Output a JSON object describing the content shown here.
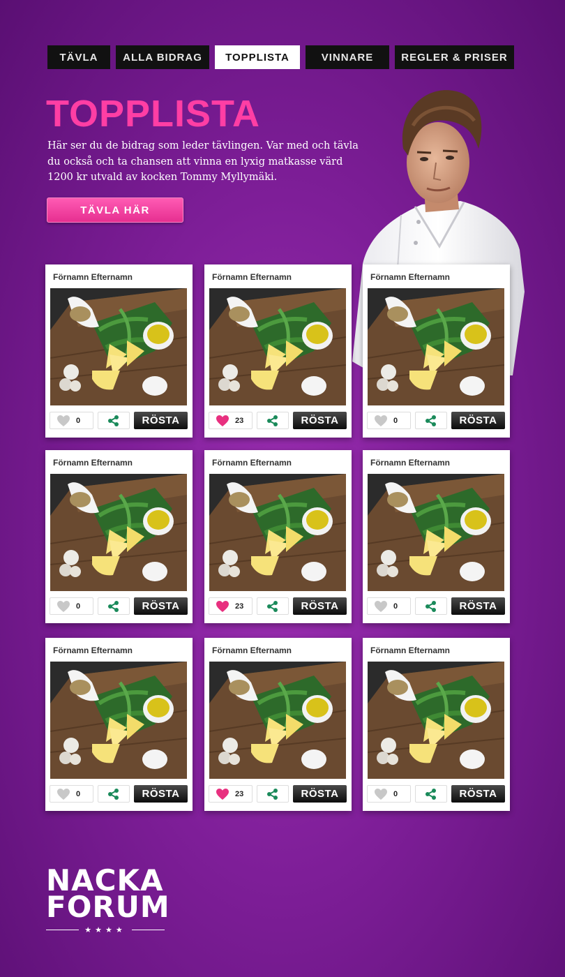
{
  "nav": {
    "tabs": [
      {
        "label": "TÄVLA",
        "active": false
      },
      {
        "label": "ALLA BIDRAG",
        "active": false
      },
      {
        "label": "TOPPLISTA",
        "active": true
      },
      {
        "label": "VINNARE",
        "active": false
      },
      {
        "label": "REGLER & PRISER",
        "active": false
      }
    ]
  },
  "page": {
    "title": "TOPPLISTA",
    "intro": "Här ser du de bidrag som leder tävlingen. Var med och tävla du också och ta chansen att vinna en lyxig matkasse värd 1200 kr utvald av kocken Tommy Myllymäki.",
    "cta_label": "TÄVLA HÄR"
  },
  "entries": [
    {
      "name": "Förnamn Efternamn",
      "likes": "0",
      "liked": false,
      "vote_label": "RÖSTA"
    },
    {
      "name": "Förnamn Efternamn",
      "likes": "23",
      "liked": true,
      "vote_label": "RÖSTA"
    },
    {
      "name": "Förnamn Efternamn",
      "likes": "0",
      "liked": false,
      "vote_label": "RÖSTA"
    },
    {
      "name": "Förnamn Efternamn",
      "likes": "0",
      "liked": false,
      "vote_label": "RÖSTA"
    },
    {
      "name": "Förnamn Efternamn",
      "likes": "23",
      "liked": true,
      "vote_label": "RÖSTA"
    },
    {
      "name": "Förnamn Efternamn",
      "likes": "0",
      "liked": false,
      "vote_label": "RÖSTA"
    },
    {
      "name": "Förnamn Efternamn",
      "likes": "0",
      "liked": false,
      "vote_label": "RÖSTA"
    },
    {
      "name": "Förnamn Efternamn",
      "likes": "23",
      "liked": true,
      "vote_label": "RÖSTA"
    },
    {
      "name": "Förnamn Efternamn",
      "likes": "0",
      "liked": false,
      "vote_label": "RÖSTA"
    }
  ],
  "icons": {
    "like": "heart-icon",
    "share": "share-icon"
  },
  "colors": {
    "accent_pink": "#ff3ea4",
    "heart_active": "#e8307f",
    "heart_inactive": "#c8c8c8",
    "share_green": "#1a8a5a",
    "background_purple": "#7e1e98"
  },
  "footer": {
    "logo_line1": "NACKA",
    "logo_line2": "FORUM",
    "logo_stars": "★★★★"
  }
}
